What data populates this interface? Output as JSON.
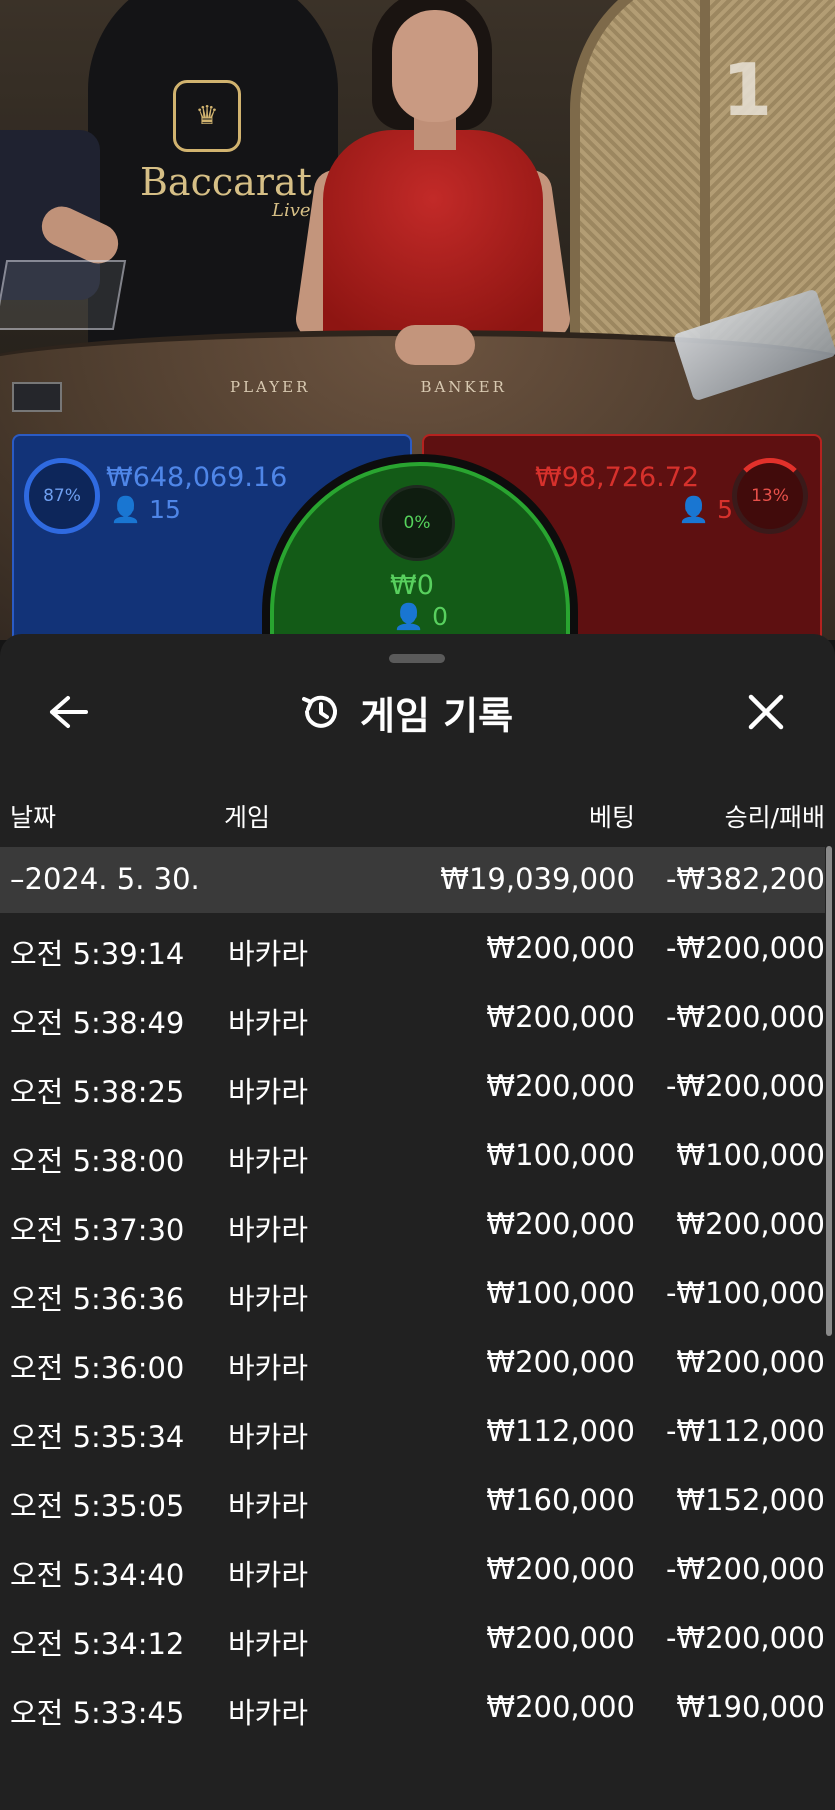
{
  "video": {
    "logo_text": "Baccarat",
    "logo_sub": "Live",
    "table_number": "1",
    "felt_player": "PLAYER",
    "felt_banker": "BANKER"
  },
  "bets": {
    "player": {
      "percent": "87%",
      "amount": "₩648,069.16",
      "players": "15",
      "color": "#2f6ae0"
    },
    "tie": {
      "percent": "0%",
      "amount": "₩0",
      "players": "0",
      "color": "#29a530"
    },
    "banker": {
      "percent": "13%",
      "amount": "₩98,726.72",
      "players": "5",
      "color": "#d7312c"
    }
  },
  "sheet": {
    "title": "게임 기록",
    "icons": {
      "back": "arrow-left-icon",
      "title": "history-icon",
      "close": "close-icon"
    },
    "headers": {
      "date": "날짜",
      "game": "게임",
      "bet": "베팅",
      "result": "승리/패배"
    },
    "date_group": {
      "label": "–2024. 5. 30.",
      "bet": "₩19,039,000",
      "result": "-₩382,200"
    },
    "rows": [
      {
        "time": "오전 5:39:14",
        "game": "바카라",
        "bet": "₩200,000",
        "result": "-₩200,000"
      },
      {
        "time": "오전 5:38:49",
        "game": "바카라",
        "bet": "₩200,000",
        "result": "-₩200,000"
      },
      {
        "time": "오전 5:38:25",
        "game": "바카라",
        "bet": "₩200,000",
        "result": "-₩200,000"
      },
      {
        "time": "오전 5:38:00",
        "game": "바카라",
        "bet": "₩100,000",
        "result": "₩100,000"
      },
      {
        "time": "오전 5:37:30",
        "game": "바카라",
        "bet": "₩200,000",
        "result": "₩200,000"
      },
      {
        "time": "오전 5:36:36",
        "game": "바카라",
        "bet": "₩100,000",
        "result": "-₩100,000"
      },
      {
        "time": "오전 5:36:00",
        "game": "바카라",
        "bet": "₩200,000",
        "result": "₩200,000"
      },
      {
        "time": "오전 5:35:34",
        "game": "바카라",
        "bet": "₩112,000",
        "result": "-₩112,000"
      },
      {
        "time": "오전 5:35:05",
        "game": "바카라",
        "bet": "₩160,000",
        "result": "₩152,000"
      },
      {
        "time": "오전 5:34:40",
        "game": "바카라",
        "bet": "₩200,000",
        "result": "-₩200,000"
      },
      {
        "time": "오전 5:34:12",
        "game": "바카라",
        "bet": "₩200,000",
        "result": "-₩200,000"
      },
      {
        "time": "오전 5:33:45",
        "game": "바카라",
        "bet": "₩200,000",
        "result": "₩190,000"
      }
    ]
  }
}
